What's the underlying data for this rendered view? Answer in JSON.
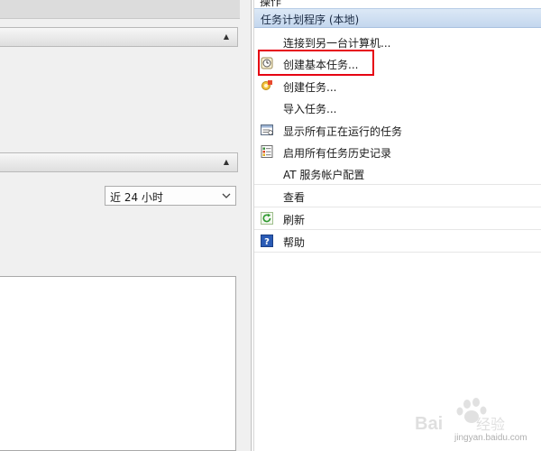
{
  "left": {
    "range_select": {
      "value": "近 24 小时"
    }
  },
  "actions_pane": {
    "title": "操作",
    "group_header": "任务计划程序 (本地)",
    "items": [
      {
        "label": "连接到另一台计算机...",
        "icon": "none"
      },
      {
        "label": "创建基本任务...",
        "icon": "clock-task-icon",
        "highlighted": true
      },
      {
        "label": "创建任务...",
        "icon": "task-icon"
      },
      {
        "label": "导入任务...",
        "icon": "none"
      },
      {
        "label": "显示所有正在运行的任务",
        "icon": "running-tasks-icon"
      },
      {
        "label": "启用所有任务历史记录",
        "icon": "history-icon"
      },
      {
        "label": "AT 服务帐户配置",
        "icon": "none"
      },
      {
        "label": "查看",
        "icon": "none"
      },
      {
        "label": "刷新",
        "icon": "refresh-icon"
      },
      {
        "label": "帮助",
        "icon": "help-icon"
      }
    ]
  },
  "colors": {
    "highlight_border": "#e60012",
    "group_header_bg": "#c4d7ee"
  },
  "watermark": {
    "logo": "Baidu 经验",
    "url": "jingyan.baidu.com"
  }
}
